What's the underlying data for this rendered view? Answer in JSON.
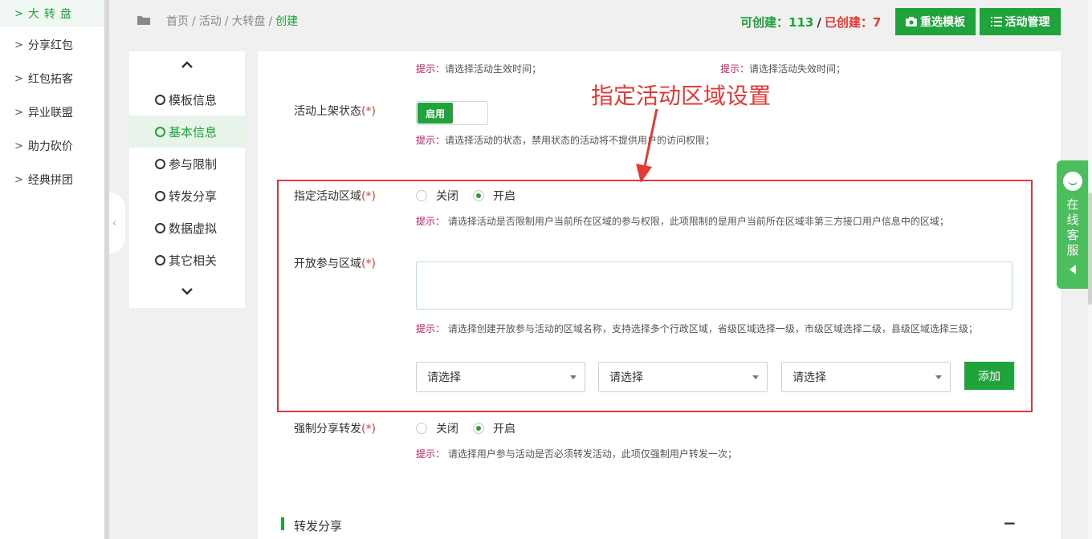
{
  "sidebar": {
    "items": [
      {
        "label": "大转盘",
        "active": true
      },
      {
        "label": "分享红包"
      },
      {
        "label": "红包拓客"
      },
      {
        "label": "异业联盟"
      },
      {
        "label": "助力砍价"
      },
      {
        "label": "经典拼团"
      }
    ]
  },
  "header": {
    "breadcrumb": [
      "首页",
      "活动",
      "大转盘",
      "创建"
    ],
    "quota": {
      "can_create_label": "可创建：",
      "can_create_value": "113",
      "created_label": "已创建：",
      "created_value": "7"
    },
    "reselect_label": "重选模板",
    "manage_label": "活动管理"
  },
  "stepnav": {
    "steps": [
      "模板信息",
      "基本信息",
      "参与限制",
      "转发分享",
      "数据虚拟",
      "其它相关"
    ],
    "active_index": 1
  },
  "form": {
    "hint_prefix": "提示：",
    "start_time_hint": "请选择活动生效时间；",
    "end_time_hint": "请选择活动失效时间；",
    "status_label": "活动上架状态",
    "status_toggle": "启用",
    "status_hint": "请选择活动的状态，禁用状态的活动将不提供用户的访问权限；",
    "region_label": "指定活动区域",
    "region_off": "关闭",
    "region_on": "开启",
    "region_hint": "请选择活动是否限制用户当前所在区域的参与权限，此项限制的是用户当前所在区域非第三方接口用户信息中的区域；",
    "open_region_label": "开放参与区域",
    "open_region_hint": "请选择创建开放参与活动的区域名称，支持选择多个行政区域，省级区域选择一级，市级区域选择二级，县级区域选择三级；",
    "select_placeholder": "请选择",
    "add_label": "添加",
    "share_label": "强制分享转发",
    "share_off": "关闭",
    "share_on": "开启",
    "share_hint": "请选择用户参与活动是否必须转发活动，此项仅强制用户转发一次；",
    "required_mark": "(*)"
  },
  "annotation": "指定活动区域设置",
  "section": {
    "title": "转发分享",
    "collapse": "−"
  },
  "service": {
    "label": "在线客服"
  },
  "colors": {
    "accent": "#1fa33b",
    "alert": "#e53935",
    "hint": "#c2185b",
    "service": "#4cbe5e"
  }
}
